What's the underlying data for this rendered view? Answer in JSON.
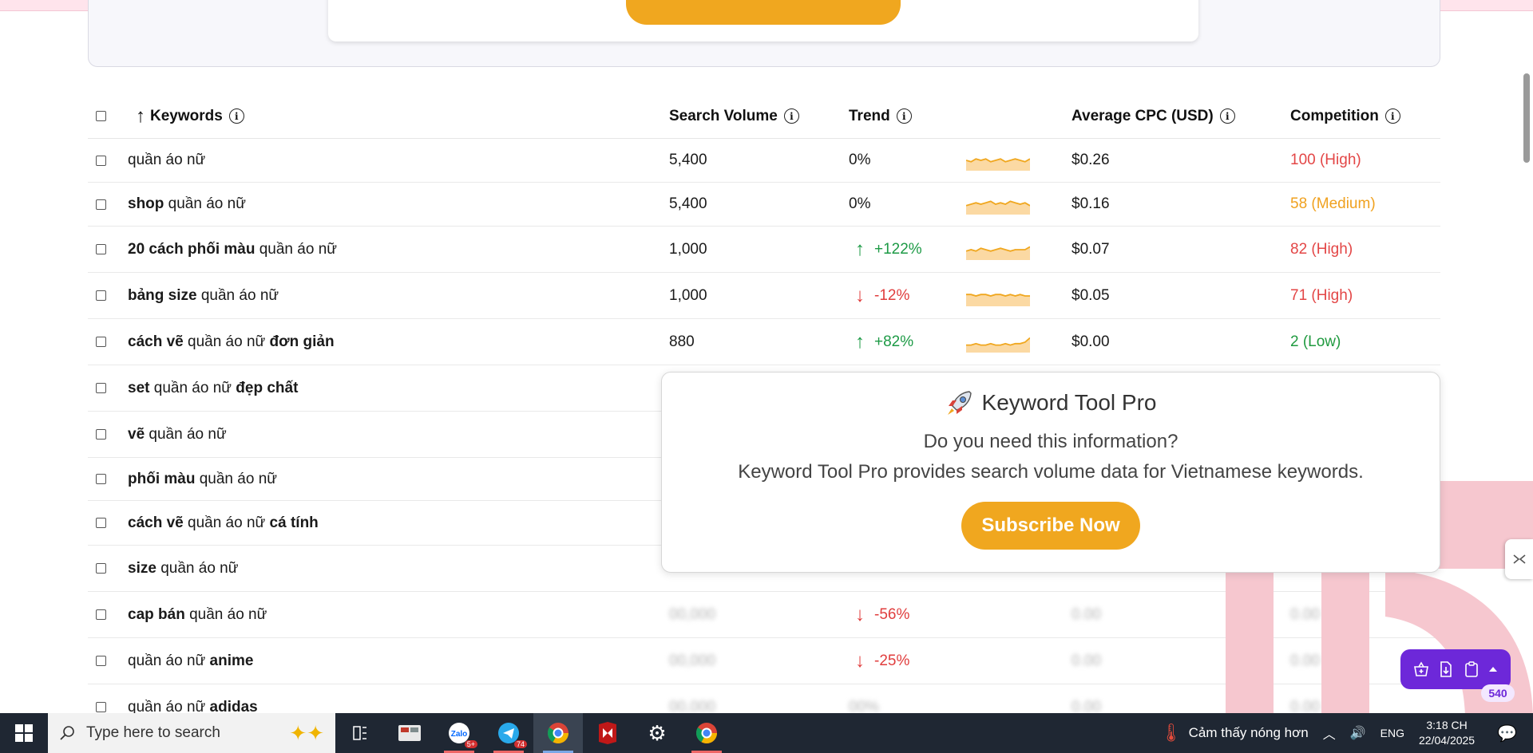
{
  "table": {
    "headers": {
      "keywords": "Keywords",
      "search_volume": "Search Volume",
      "trend": "Trend",
      "avg_cpc": "Average CPC (USD)",
      "competition": "Competition"
    },
    "sort_arrow": "↑",
    "info_glyph": "i",
    "rows": [
      {
        "kw_prefix": "",
        "kw_bold1": "",
        "kw_mid": "quần áo nữ",
        "kw_bold2": "",
        "volume": "5,400",
        "trend_arrow": "",
        "trend": "0%",
        "trend_dir": "flat",
        "cpc": "$0.26",
        "competition": "100 (High)",
        "comp_level": "high",
        "spark": [
          5,
          4,
          6,
          5,
          6,
          4,
          5,
          6,
          4,
          5,
          6,
          5,
          4,
          6
        ]
      },
      {
        "kw_prefix": "",
        "kw_bold1": "shop",
        "kw_mid": " quần áo nữ",
        "kw_bold2": "",
        "volume": "5,400",
        "trend_arrow": "",
        "trend": "0%",
        "trend_dir": "flat",
        "cpc": "$0.16",
        "competition": "58 (Medium)",
        "comp_level": "medium",
        "spark": [
          4,
          5,
          6,
          5,
          6,
          7,
          5,
          6,
          5,
          7,
          6,
          5,
          6,
          4
        ]
      },
      {
        "kw_prefix": "",
        "kw_bold1": "20 cách phối màu",
        "kw_mid": " quần áo nữ",
        "kw_bold2": "",
        "volume": "1,000",
        "trend_arrow": "↑",
        "trend": "+122%",
        "trend_dir": "up",
        "cpc": "$0.07",
        "competition": "82 (High)",
        "comp_level": "high",
        "spark": [
          4,
          5,
          4,
          6,
          5,
          4,
          5,
          6,
          5,
          4,
          5,
          5,
          5,
          7
        ]
      },
      {
        "kw_prefix": "",
        "kw_bold1": "bảng size",
        "kw_mid": " quần áo nữ",
        "kw_bold2": "",
        "volume": "1,000",
        "trend_arrow": "↓",
        "trend": "-12%",
        "trend_dir": "down",
        "cpc": "$0.05",
        "competition": "71 (High)",
        "comp_level": "high",
        "spark": [
          6,
          6,
          5,
          6,
          6,
          5,
          6,
          6,
          5,
          6,
          5,
          6,
          5,
          5
        ]
      },
      {
        "kw_prefix": "",
        "kw_bold1": "cách vẽ",
        "kw_mid": " quần áo nữ ",
        "kw_bold2": "đơn giản",
        "volume": "880",
        "trend_arrow": "↑",
        "trend": "+82%",
        "trend_dir": "up",
        "cpc": "$0.00",
        "competition": "2 (Low)",
        "comp_level": "low",
        "spark": [
          3,
          3,
          4,
          3,
          3,
          4,
          3,
          3,
          4,
          3,
          4,
          4,
          5,
          8
        ]
      },
      {
        "kw_prefix": "",
        "kw_bold1": "set",
        "kw_mid": " quần áo nữ ",
        "kw_bold2": "đẹp chất",
        "volume": "",
        "trend_arrow": "",
        "trend": "",
        "trend_dir": "none",
        "cpc": "",
        "competition": "",
        "comp_level": "none",
        "spark": []
      },
      {
        "kw_prefix": "",
        "kw_bold1": "vẽ",
        "kw_mid": " quần áo nữ",
        "kw_bold2": "",
        "volume": "",
        "trend_arrow": "",
        "trend": "",
        "trend_dir": "none",
        "cpc": "",
        "competition": "",
        "comp_level": "none",
        "spark": []
      },
      {
        "kw_prefix": "",
        "kw_bold1": "phối màu",
        "kw_mid": " quần áo nữ",
        "kw_bold2": "",
        "volume": "",
        "trend_arrow": "",
        "trend": "",
        "trend_dir": "none",
        "cpc": "",
        "competition": "",
        "comp_level": "none",
        "spark": []
      },
      {
        "kw_prefix": "",
        "kw_bold1": "cách vẽ",
        "kw_mid": " quần áo nữ ",
        "kw_bold2": "cá tính",
        "volume": "",
        "trend_arrow": "",
        "trend": "",
        "trend_dir": "none",
        "cpc": "",
        "competition": "",
        "comp_level": "none",
        "spark": []
      },
      {
        "kw_prefix": "",
        "kw_bold1": "size",
        "kw_mid": " quần áo nữ",
        "kw_bold2": "",
        "volume": "",
        "trend_arrow": "",
        "trend": "",
        "trend_dir": "none",
        "cpc": "",
        "competition": "",
        "comp_level": "none",
        "spark": []
      },
      {
        "kw_prefix": "",
        "kw_bold1": "cap bán",
        "kw_mid": " quần áo nữ",
        "kw_bold2": "",
        "volume": "00,000",
        "trend_arrow": "↓",
        "trend": "-56%",
        "trend_dir": "down",
        "cpc": "0.00",
        "competition": "0.00",
        "comp_level": "blur",
        "spark": []
      },
      {
        "kw_prefix": "",
        "kw_bold1": "",
        "kw_mid": "quần áo nữ ",
        "kw_bold2": "anime",
        "volume": "00,000",
        "trend_arrow": "↓",
        "trend": "-25%",
        "trend_dir": "down",
        "cpc": "0.00",
        "competition": "0.00",
        "comp_level": "blur",
        "spark": []
      },
      {
        "kw_prefix": "",
        "kw_bold1": "",
        "kw_mid": "quần áo nữ ",
        "kw_bold2": "adidas",
        "volume": "00,000",
        "trend_arrow": "",
        "trend": "00%",
        "trend_dir": "blur",
        "cpc": "0.00",
        "competition": "0.00",
        "comp_level": "blur",
        "spark": []
      }
    ]
  },
  "popup": {
    "icon": "rocket-icon",
    "title": "Keyword Tool Pro",
    "question": "Do you need this information?",
    "description": "Keyword Tool Pro provides search volume data for Vietnamese keywords.",
    "button": "Subscribe Now"
  },
  "float_toolbar": {
    "badge": "540",
    "icons": [
      "basket-icon",
      "download-icon",
      "clipboard-icon",
      "caret-up-icon"
    ]
  },
  "taskbar": {
    "search_placeholder": "Type here to search",
    "weather": "Cảm thấy nóng hơn",
    "language": "ENG",
    "time": "3:18 CH",
    "date": "22/04/2025",
    "telegram_badge": "74",
    "zalo_badge": "5+"
  },
  "colors": {
    "accent": "#f0a71f",
    "high": "#e34646",
    "medium": "#f0a11f",
    "low": "#1f9a3f",
    "up": "#1c9a45",
    "down": "#e03d3d",
    "spark_line": "#f0a71f",
    "spark_fill": "#fbd9a3",
    "watermark": "#f6c7cf",
    "toolbar": "#6d28d9"
  }
}
